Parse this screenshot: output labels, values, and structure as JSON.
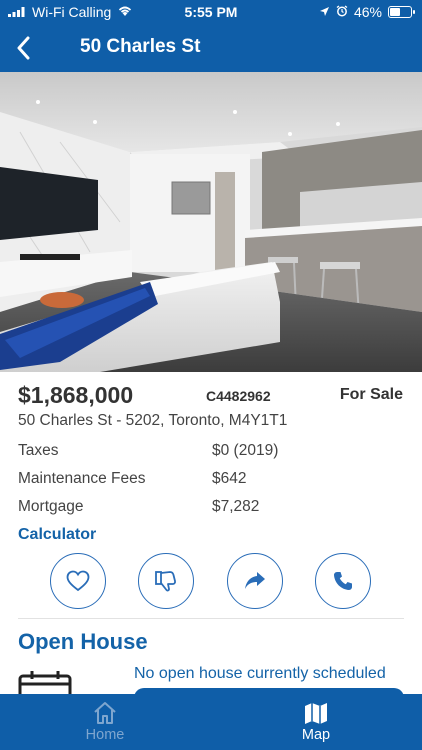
{
  "status_bar": {
    "carrier": "Wi-Fi Calling",
    "time": "5:55 PM",
    "battery": "46%",
    "battery_level": 0.46
  },
  "nav": {
    "title": "50 Charles St",
    "back_icon": "chevron-left-icon"
  },
  "listing": {
    "price": "$1,868,000",
    "mls": "C4482962",
    "status": "For Sale",
    "address": "50 Charles St - 5202, Toronto, M4Y1T1",
    "details": [
      {
        "label": "Taxes",
        "value": "$0 (2019)"
      },
      {
        "label": "Maintenance Fees",
        "value": "$642"
      },
      {
        "label": "Mortgage",
        "value": "$7,282"
      }
    ],
    "calculator_link": "Calculator"
  },
  "actions": [
    "heart-icon",
    "thumbs-down-icon",
    "share-icon",
    "phone-icon"
  ],
  "open_house": {
    "title": "Open House",
    "message": "No open house currently scheduled"
  },
  "tabs": [
    {
      "label": "Home",
      "icon": "home-icon",
      "active": false
    },
    {
      "label": "Map",
      "icon": "map-icon",
      "active": true
    }
  ],
  "colors": {
    "primary": "#0f5ea8",
    "link": "#1463a8",
    "tab_inactive": "#7ea6cf"
  }
}
